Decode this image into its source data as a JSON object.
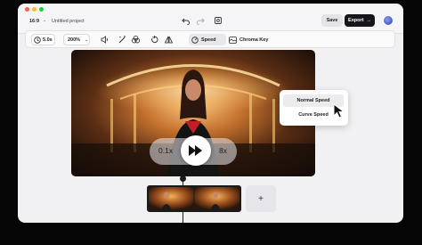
{
  "titlebar": {
    "aspect_ratio": "16:9",
    "project_title": "Untitled project",
    "save_label": "Save",
    "export_label": "Export",
    "export_arrow": "→"
  },
  "toolbar": {
    "duration": "5.0s",
    "zoom": "200%",
    "chevron": "⌄",
    "speed_label": "Speed",
    "chroma_label": "Chroma Key"
  },
  "player": {
    "min_speed": "0.1x",
    "max_speed": "8x"
  },
  "speed_menu": {
    "items": [
      "Normal Speed",
      "Curve Speed"
    ],
    "selected": "Normal Speed"
  },
  "timeline": {
    "add_label": "+"
  },
  "colors": {
    "accent": "#16161a",
    "window_bg": "#f1f1f3",
    "menu_active": "#ececee"
  },
  "icons": [
    "undo-icon",
    "redo-icon",
    "fit-icon",
    "clock-icon",
    "volume-icon",
    "magic-wand-icon",
    "color-filter-icon",
    "rotate-icon",
    "flip-icon",
    "speedometer-icon",
    "chroma-key-icon",
    "play-forward-icon",
    "cursor-icon"
  ]
}
